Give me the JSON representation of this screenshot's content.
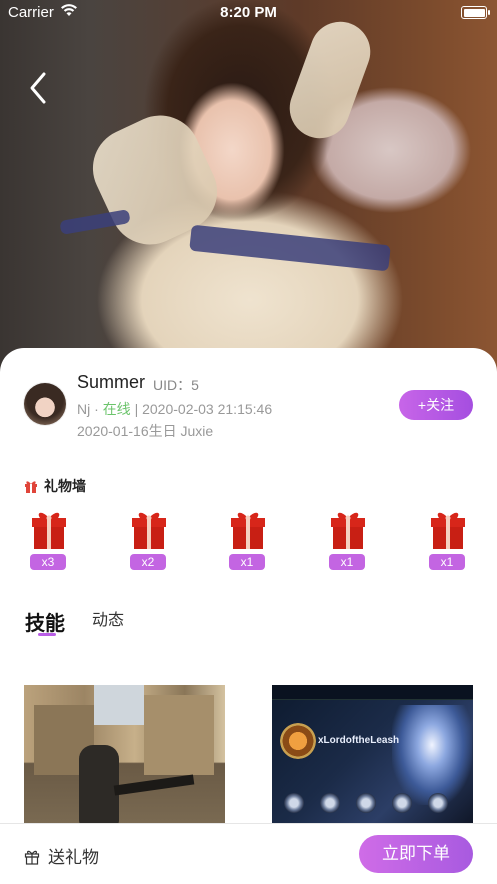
{
  "status_bar": {
    "carrier": "Carrier",
    "time": "8:20 PM",
    "wifi_icon": "wifi-icon",
    "battery_icon": "battery-icon"
  },
  "nav": {
    "back_icon": "chevron-left-icon"
  },
  "profile": {
    "name": "Summer",
    "uid_label": "UID：5",
    "location": "Nj",
    "separator1": " · ",
    "status": "在线",
    "separator2": " | ",
    "last_active": "2020-02-03 21:15:46",
    "birthday_line": "2020-01-16生日 Juxie",
    "follow_label": "+关注"
  },
  "gift_wall": {
    "title": "礼物墙",
    "icon": "gift-icon",
    "gifts": [
      {
        "icon": "gift-box-icon",
        "count": "x3"
      },
      {
        "icon": "gift-box-icon",
        "count": "x2"
      },
      {
        "icon": "gift-box-icon",
        "count": "x1"
      },
      {
        "icon": "gift-box-icon",
        "count": "x1"
      },
      {
        "icon": "gift-box-icon",
        "count": "x1"
      }
    ]
  },
  "tabs": [
    {
      "label": "技能",
      "active": true
    },
    {
      "label": "动态",
      "active": false
    }
  ],
  "skills": {
    "lol_summoner_name": "xLordoftheLeash"
  },
  "bottom_bar": {
    "send_gift_label": "送礼物",
    "send_gift_icon": "gift-outline-icon",
    "order_label": "立即下单"
  },
  "colors": {
    "accent": "#b95ee6",
    "gift_red": "#d7261a",
    "online_green": "#6cc46c"
  }
}
